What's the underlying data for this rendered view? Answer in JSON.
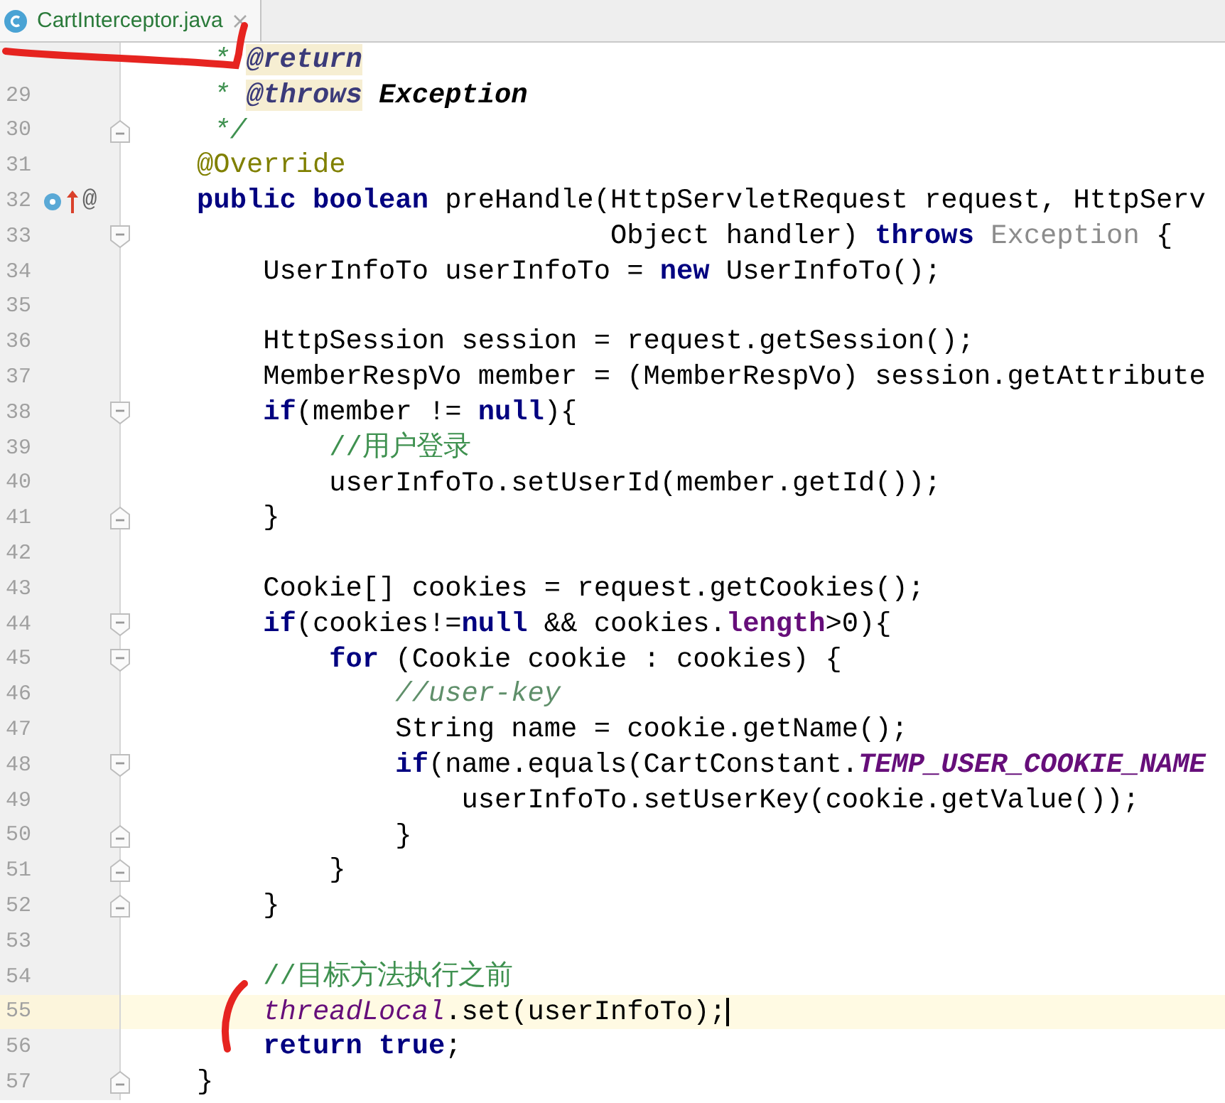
{
  "tab": {
    "title": "CartInterceptor.java",
    "selected": true
  },
  "lines": [
    {
      "current": false,
      "tokens": [
        {
          "kind": "doc",
          "text": "     * "
        },
        {
          "kind": "doctag",
          "text": "@return"
        }
      ]
    },
    {
      "number": "29",
      "current": false,
      "tokens": [
        {
          "kind": "doc",
          "text": "     * "
        },
        {
          "kind": "doctag",
          "text": "@throws"
        },
        {
          "kind": "docbold",
          "text": " Exception"
        }
      ]
    },
    {
      "number": "30",
      "current": false,
      "fold_marker": {
        "kind": "end"
      },
      "tokens": [
        {
          "kind": "doc",
          "text": "     */"
        }
      ]
    },
    {
      "number": "31",
      "current": false,
      "tokens": [
        {
          "kind": "annotation",
          "text": "    @Override"
        }
      ]
    },
    {
      "number": "32",
      "current": false,
      "markers": [
        {
          "kind": "implementing"
        },
        {
          "kind": "overriding"
        },
        {
          "kind": "glyph",
          "text": "@"
        }
      ],
      "tokens": [
        {
          "kind": "keyword",
          "text": "    public boolean"
        },
        {
          "kind": "plain",
          "text": " preHandle(HttpServletRequest request, HttpServ"
        }
      ]
    },
    {
      "number": "33",
      "current": false,
      "fold_marker": {
        "kind": "start"
      },
      "tokens": [
        {
          "kind": "plain",
          "text": "                             Object handler) "
        },
        {
          "kind": "keyword",
          "text": "throws"
        },
        {
          "kind": "unused",
          "text": " Exception"
        },
        {
          "kind": "plain",
          "text": " {"
        }
      ]
    },
    {
      "number": "34",
      "current": false,
      "tokens": [
        {
          "kind": "plain",
          "text": "        UserInfoTo userInfoTo = "
        },
        {
          "kind": "keyword",
          "text": "new"
        },
        {
          "kind": "plain",
          "text": " UserInfoTo();"
        }
      ]
    },
    {
      "number": "35",
      "current": false
    },
    {
      "number": "36",
      "current": false,
      "tokens": [
        {
          "kind": "plain",
          "text": "        HttpSession session = request.getSession();"
        }
      ]
    },
    {
      "number": "37",
      "current": false,
      "tokens": [
        {
          "kind": "plain",
          "text": "        MemberRespVo member = (MemberRespVo) session.getAttribute"
        }
      ]
    },
    {
      "number": "38",
      "current": false,
      "fold_marker": {
        "kind": "start"
      },
      "tokens": [
        {
          "kind": "keyword",
          "text": "        if"
        },
        {
          "kind": "plain",
          "text": "(member != "
        },
        {
          "kind": "keyword",
          "text": "null"
        },
        {
          "kind": "plain",
          "text": "){"
        }
      ]
    },
    {
      "number": "39",
      "current": false,
      "tokens": [
        {
          "kind": "comment",
          "text": "            //用户登录"
        }
      ]
    },
    {
      "number": "40",
      "current": false,
      "tokens": [
        {
          "kind": "plain",
          "text": "            userInfoTo.setUserId(member.getId());"
        }
      ]
    },
    {
      "number": "41",
      "current": false,
      "fold_marker": {
        "kind": "end"
      },
      "tokens": [
        {
          "kind": "plain",
          "text": "        }"
        }
      ]
    },
    {
      "number": "42",
      "current": false
    },
    {
      "number": "43",
      "current": false,
      "tokens": [
        {
          "kind": "plain",
          "text": "        Cookie[] cookies = request.getCookies();"
        }
      ]
    },
    {
      "number": "44",
      "current": false,
      "fold_marker": {
        "kind": "start"
      },
      "tokens": [
        {
          "kind": "keyword",
          "text": "        if"
        },
        {
          "kind": "plain",
          "text": "(cookies!="
        },
        {
          "kind": "keyword",
          "text": "null"
        },
        {
          "kind": "plain",
          "text": " && cookies."
        },
        {
          "kind": "member",
          "text": "length"
        },
        {
          "kind": "plain",
          "text": ">0){"
        }
      ]
    },
    {
      "number": "45",
      "current": false,
      "fold_marker": {
        "kind": "start"
      },
      "tokens": [
        {
          "kind": "keyword",
          "text": "            for"
        },
        {
          "kind": "plain",
          "text": " (Cookie cookie : cookies) {"
        }
      ]
    },
    {
      "number": "46",
      "current": false,
      "tokens": [
        {
          "kind": "comment-italic",
          "text": "                //user-key"
        }
      ]
    },
    {
      "number": "47",
      "current": false,
      "tokens": [
        {
          "kind": "plain",
          "text": "                String name = cookie.getName();"
        }
      ]
    },
    {
      "number": "48",
      "current": false,
      "fold_marker": {
        "kind": "start"
      },
      "tokens": [
        {
          "kind": "keyword",
          "text": "                if"
        },
        {
          "kind": "plain",
          "text": "(name.equals(CartConstant."
        },
        {
          "kind": "static",
          "text": "TEMP_USER_COOKIE_NAME"
        }
      ]
    },
    {
      "number": "49",
      "current": false,
      "tokens": [
        {
          "kind": "plain",
          "text": "                    userInfoTo.setUserKey(cookie.getValue());"
        }
      ]
    },
    {
      "number": "50",
      "current": false,
      "fold_marker": {
        "kind": "end"
      },
      "tokens": [
        {
          "kind": "plain",
          "text": "                }"
        }
      ]
    },
    {
      "number": "51",
      "current": false,
      "fold_marker": {
        "kind": "end"
      },
      "tokens": [
        {
          "kind": "plain",
          "text": "            }"
        }
      ]
    },
    {
      "number": "52",
      "current": false,
      "fold_marker": {
        "kind": "end"
      },
      "tokens": [
        {
          "kind": "plain",
          "text": "        }"
        }
      ]
    },
    {
      "number": "53",
      "current": false
    },
    {
      "number": "54",
      "current": false,
      "tokens": [
        {
          "kind": "comment",
          "text": "        //目标方法执行之前"
        }
      ]
    },
    {
      "number": "55",
      "current": true,
      "tokens": [
        {
          "kind": "field",
          "text": "        threadLocal"
        },
        {
          "kind": "plain",
          "text": ".set(userInfoTo);"
        }
      ]
    },
    {
      "number": "56",
      "current": false,
      "tokens": [
        {
          "kind": "keyword",
          "text": "        return true"
        },
        {
          "kind": "plain",
          "text": ";"
        }
      ]
    },
    {
      "number": "57",
      "current": false,
      "fold_marker": {
        "kind": "end"
      },
      "tokens": [
        {
          "kind": "plain",
          "text": "    }"
        }
      ]
    }
  ]
}
